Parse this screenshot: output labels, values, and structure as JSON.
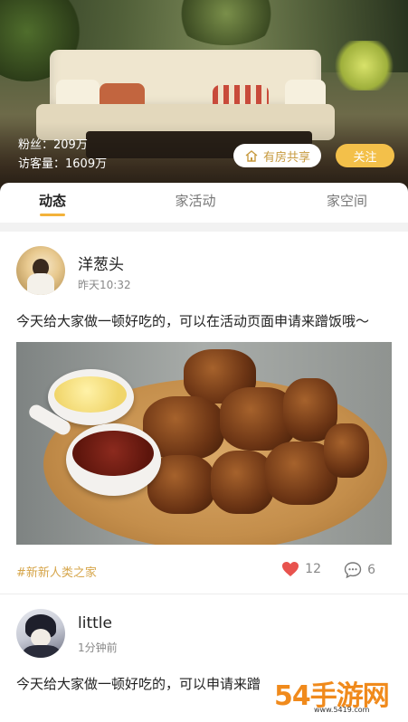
{
  "header": {
    "fans_label": "粉丝：209万",
    "visitors_label": "访客量：1609万",
    "share_button": "有房共享",
    "follow_button": "关注"
  },
  "tabs": [
    {
      "label": "动态",
      "active": true
    },
    {
      "label": "家活动",
      "active": false
    },
    {
      "label": "家空间",
      "active": false
    }
  ],
  "posts": [
    {
      "author": "洋葱头",
      "time": "昨天10:32",
      "text": "今天给大家做一顿好吃的，可以在活动页面申请来蹭饭哦～",
      "tag": "#新新人类之家",
      "likes": "12",
      "comments": "6"
    },
    {
      "author": "little",
      "time": "1分钟前",
      "text": "今天给大家做一顿好吃的，可以申请来蹭"
    }
  ],
  "watermark": {
    "text": "54手游网",
    "sub": "www.5419.com"
  },
  "colors": {
    "accent": "#f3b23a",
    "follow": "#f3c04a",
    "tag": "#d6a54a",
    "like": "#e8534e"
  },
  "icons": [
    "house-share-icon",
    "heart-icon",
    "comment-bubble-icon"
  ]
}
